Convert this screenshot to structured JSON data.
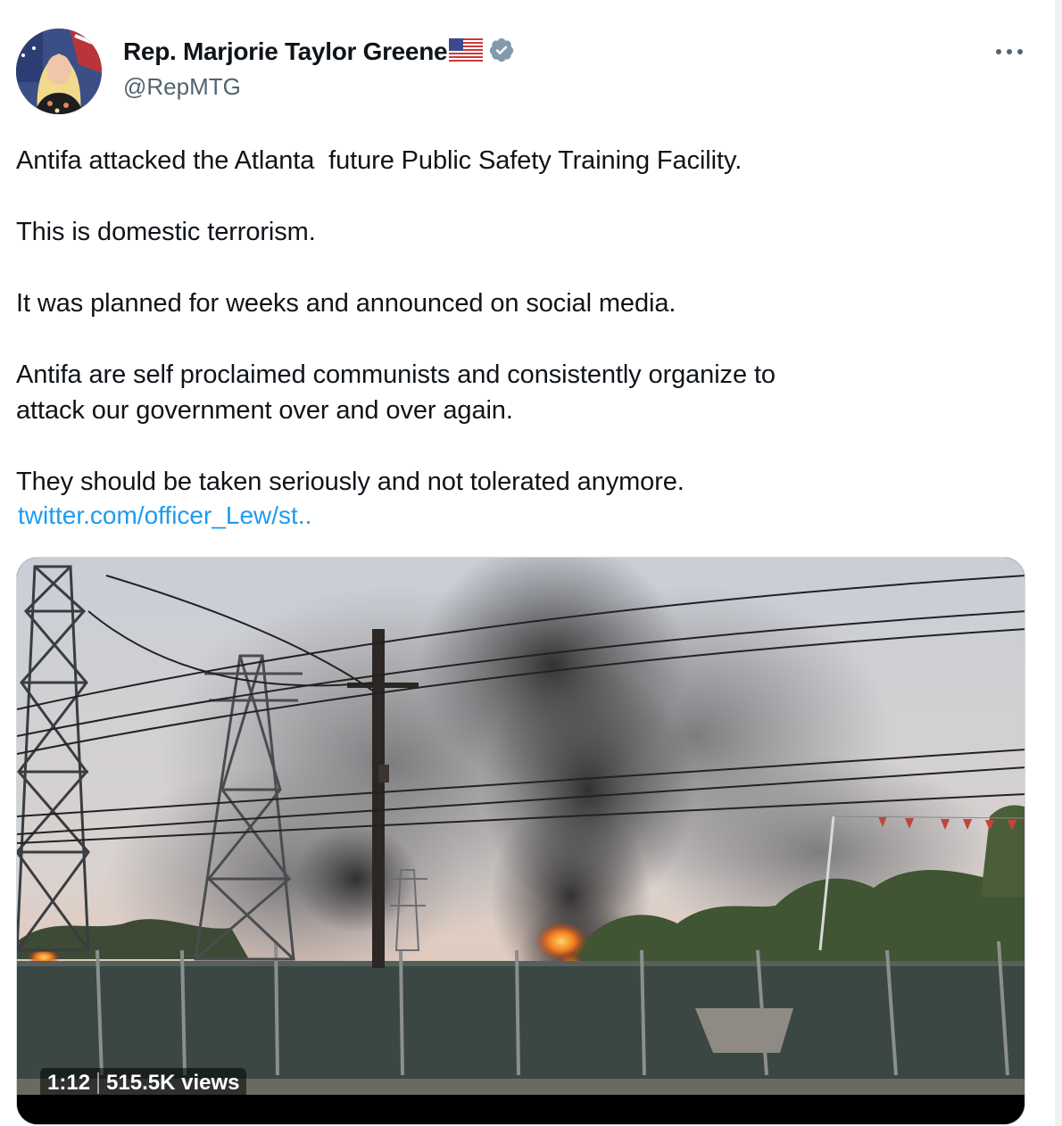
{
  "author": {
    "display_name": "Rep. Marjorie Taylor Greene",
    "handle": "@RepMTG",
    "flag_icon": "us-flag-icon",
    "verified_icon": "verified-badge-icon",
    "verified_color": "#829aab"
  },
  "menu": {
    "more_icon": "more-horizontal-icon"
  },
  "tweet": {
    "paragraphs": [
      "Antifa attacked the Atlanta  future Public Safety Training Facility.",
      "This is domestic terrorism.",
      "It was planned for weeks and announced on social media.",
      "Antifa are self proclaimed communists and consistently organize to\nattack our government over and over again.",
      "They should be taken seriously and not tolerated anymore."
    ],
    "link_text": "twitter.com/officer_Lew/st..",
    "link_color": "#1d9bf0"
  },
  "media": {
    "type": "video",
    "duration": "1:12",
    "views": "515.5K views"
  }
}
